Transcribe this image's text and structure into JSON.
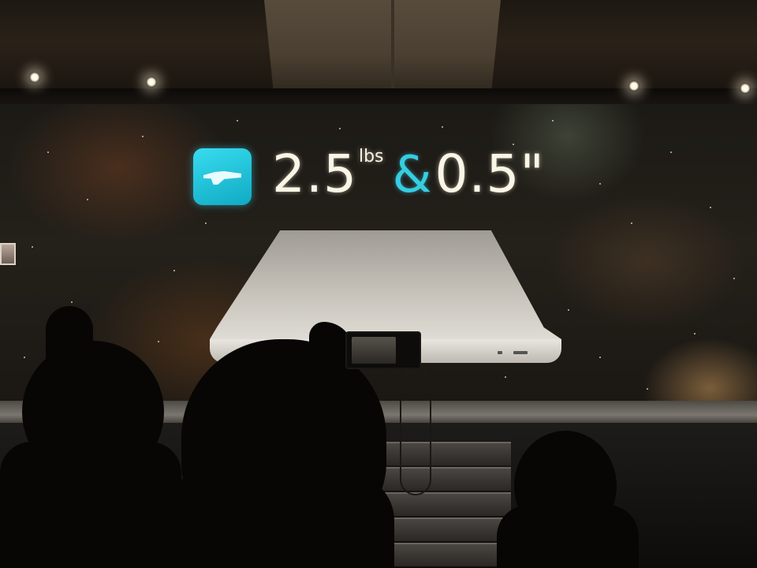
{
  "slide": {
    "weight_value": "2.5",
    "weight_unit": "lbs",
    "connector": "&",
    "thickness_value": "0.5\"",
    "icon": "airplane-icon",
    "accent_color": "#36cde0"
  }
}
